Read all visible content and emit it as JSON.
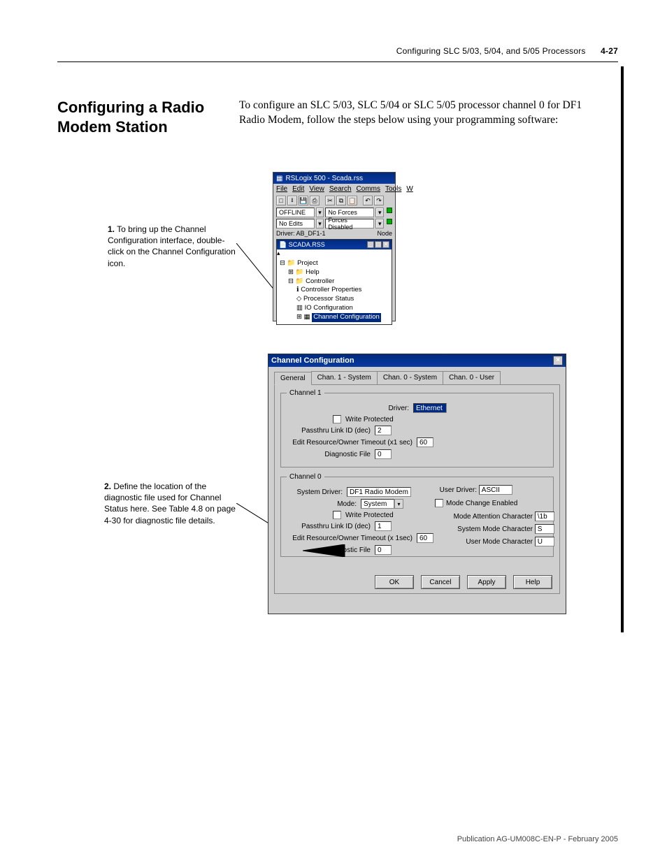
{
  "page": {
    "header": "Configuring SLC 5/03, 5/04, and 5/05 Processors",
    "pageNum": "4-27",
    "sectionTitle": "Configuring a Radio Modem Station",
    "intro": "To configure an SLC 5/03, SLC 5/04 or SLC 5/05 processor channel 0 for DF1 Radio Modem, follow the steps below using your programming software:",
    "footer": "Publication AG-UM008C-EN-P - February 2005"
  },
  "captions": {
    "c1_num": "1.",
    "c1_text": "To bring up the Channel Configuration interface, double-click on the Channel Configuration icon.",
    "c2_num": "2.",
    "c2_text": "Define the location of the diagnostic file used for Channel Status here. See Table 4.8 on page 4-30 for diagnostic file details."
  },
  "rslogix": {
    "title": "RSLogix 500 - Scada.rss",
    "menus": [
      "File",
      "Edit",
      "View",
      "Search",
      "Comms",
      "Tools",
      "W"
    ],
    "status": {
      "offline": "OFFLINE",
      "noforces": "No Forces",
      "noedits": "No Edits",
      "forcesDisabled": "Forces Disabled",
      "driverLabel": "Driver: AB_DF1-1",
      "node": "Node"
    },
    "subwin_title": "SCADA.RSS",
    "tree": {
      "project": "Project",
      "help": "Help",
      "controller": "Controller",
      "controllerProps": "Controller Properties",
      "processorStatus": "Processor Status",
      "ioConfig": "IO Configuration",
      "channelConfig": "Channel Configuration"
    }
  },
  "ccdlg": {
    "title": "Channel Configuration",
    "tabs": [
      "General",
      "Chan. 1 - System",
      "Chan. 0 - System",
      "Chan. 0 - User"
    ],
    "ch1": {
      "legend": "Channel 1",
      "driverLabel": "Driver:",
      "driver": "Ethernet",
      "writeProtected": "Write Protected",
      "passthruLabel": "Passthru Link ID (dec)",
      "passthru": "2",
      "editResLabel": "Edit Resource/Owner Timeout (x1 sec)",
      "editRes": "60",
      "diagLabel": "Diagnostic File",
      "diag": "0"
    },
    "ch0": {
      "legend": "Channel 0",
      "sysDriverLabel": "System Driver:",
      "sysDriver": "DF1 Radio Modem",
      "userDriverLabel": "User Driver:",
      "userDriver": "ASCII",
      "modeLabel": "Mode:",
      "mode": "System",
      "writeProtected": "Write Protected",
      "passthruLabel": "Passthru Link ID (dec)",
      "passthru": "1",
      "editResLabel": "Edit Resource/Owner Timeout (x 1sec)",
      "editRes": "60",
      "diagLabel": "Diagnostic File",
      "diag": "0",
      "modeChangeEnabled": "Mode Change Enabled",
      "modeAttnLabel": "Mode Attention Character",
      "modeAttn": "\\1b",
      "sysModeLabel": "System Mode Character",
      "sysMode": "S",
      "userModeLabel": "User Mode Character",
      "userMode": "U"
    },
    "buttons": {
      "ok": "OK",
      "cancel": "Cancel",
      "apply": "Apply",
      "help": "Help"
    }
  }
}
